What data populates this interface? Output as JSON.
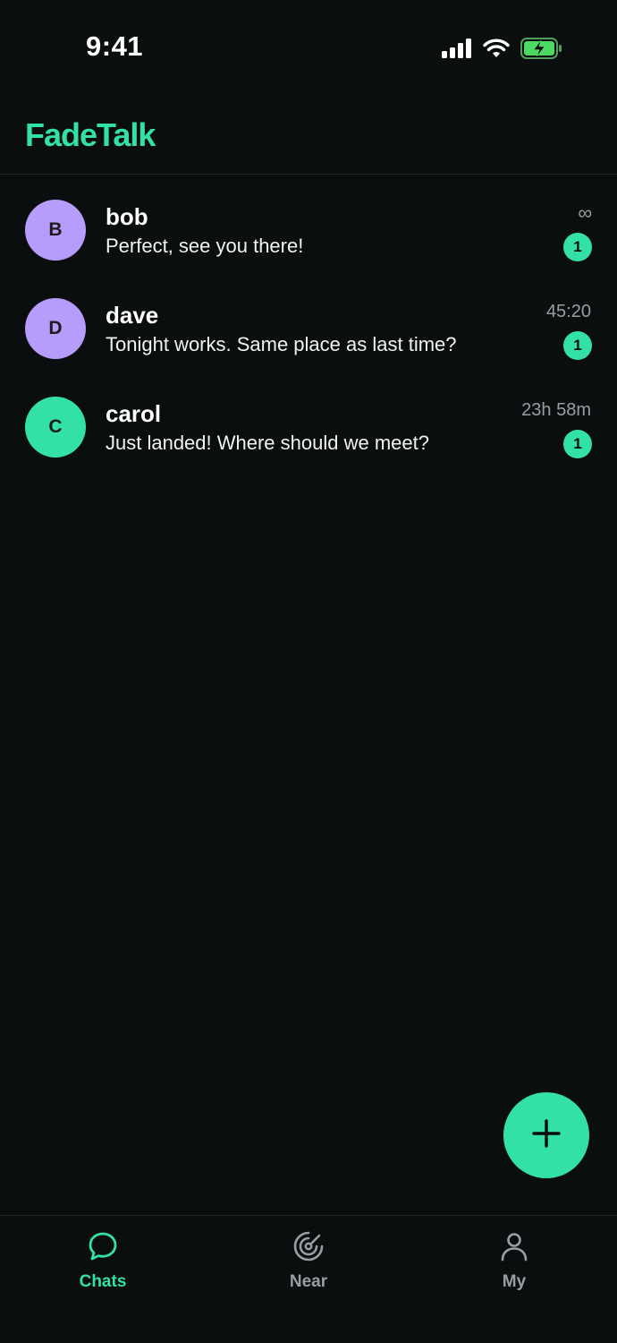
{
  "status_bar": {
    "time": "9:41"
  },
  "app": {
    "title": "FadeTalk"
  },
  "colors": {
    "accent": "#33e0a6",
    "avatar_purple": "#b79dfb",
    "muted": "#9a9ea0",
    "background": "#0a0e0e"
  },
  "chats": [
    {
      "name": "bob",
      "initial": "B",
      "preview": "Perfect, see you there!",
      "time": "∞",
      "unread": "1",
      "avatar_color": "#b79dfb"
    },
    {
      "name": "dave",
      "initial": "D",
      "preview": "Tonight works. Same place as last time?",
      "time": "45:20",
      "unread": "1",
      "avatar_color": "#b79dfb"
    },
    {
      "name": "carol",
      "initial": "C",
      "preview": "Just landed! Where should we meet?",
      "time": "23h 58m",
      "unread": "1",
      "avatar_color": "#33e0a6"
    }
  ],
  "fab": {
    "icon": "plus-icon"
  },
  "tabs": [
    {
      "label": "Chats",
      "icon": "chat-bubble-icon",
      "active": true
    },
    {
      "label": "Near",
      "icon": "radar-icon",
      "active": false
    },
    {
      "label": "My",
      "icon": "person-icon",
      "active": false
    }
  ]
}
